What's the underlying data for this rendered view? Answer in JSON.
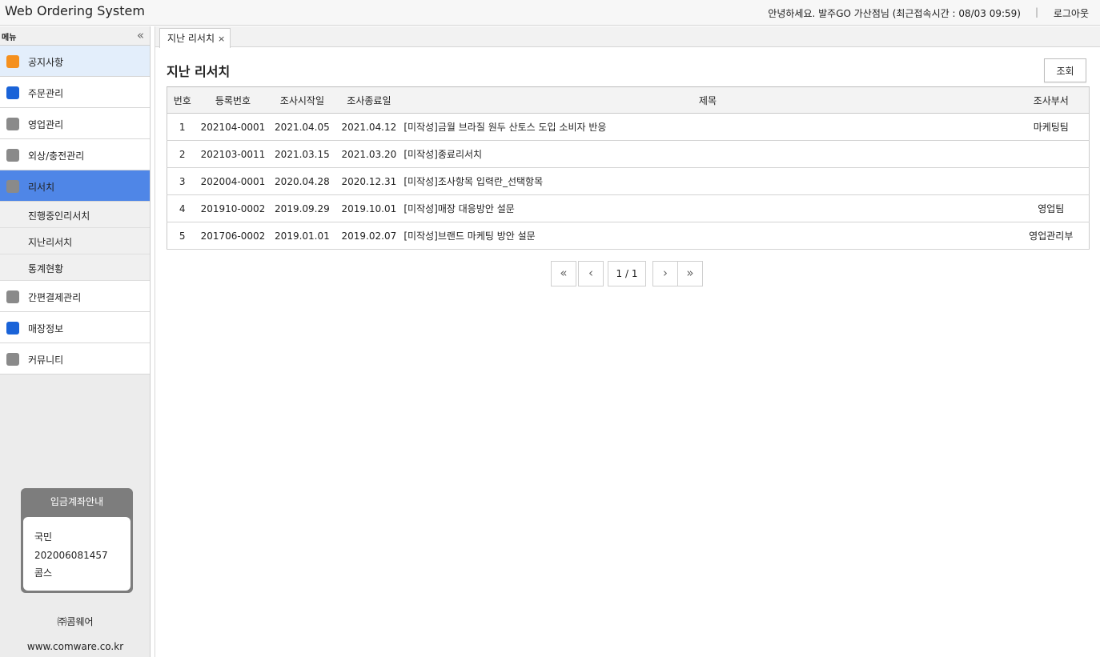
{
  "header": {
    "app_title": "Web Ordering System",
    "user_info": "안녕하세요. 발주GO 가산점님 (최근접속시간 : 08/03 09:59)",
    "separator": "|",
    "logout_label": "로그아웃"
  },
  "sidebar": {
    "menu_label": "메뉴",
    "collapse_icon": "«",
    "items": [
      {
        "label": "공지사항",
        "icon_color": "#f5901e"
      },
      {
        "label": "주문관리",
        "icon_color": "#1a63d8"
      },
      {
        "label": "영업관리",
        "icon_color": "#8a8a8a"
      },
      {
        "label": "외상/충전관리",
        "icon_color": "#8a8a8a"
      },
      {
        "label": "리서치",
        "icon_color": "#8a8a8a",
        "active": true
      },
      {
        "label": "간편결제관리",
        "icon_color": "#8a8a8a"
      },
      {
        "label": "매장정보",
        "icon_color": "#1a63d8"
      },
      {
        "label": "커뮤니티",
        "icon_color": "#8a8a8a"
      }
    ],
    "submenu": [
      "진행중인리서치",
      "지난리서치",
      "통계현황"
    ],
    "account_box": {
      "title": "입금계좌안내",
      "bank": "국민",
      "number": "202006081457",
      "holder": "콤스"
    },
    "company": "㈜콤웨어",
    "website": "www.comware.co.kr"
  },
  "tabs": [
    {
      "label": "지난 리서치",
      "close": "×"
    }
  ],
  "main": {
    "title": "지난 리서치",
    "search_button": "조회",
    "columns": [
      "번호",
      "등록번호",
      "조사시작일",
      "조사종료일",
      "제목",
      "조사부서"
    ],
    "rows": [
      [
        "1",
        "202104-0001",
        "2021.04.05",
        "2021.04.12",
        "[미작성]금월 브라질 원두 산토스 도입 소비자 반응",
        "마케팅팀"
      ],
      [
        "2",
        "202103-0011",
        "2021.03.15",
        "2021.03.20",
        "[미작성]종료리서치",
        ""
      ],
      [
        "3",
        "202004-0001",
        "2020.04.28",
        "2020.12.31",
        "[미작성]조사항목 입력란_선택항목",
        ""
      ],
      [
        "4",
        "201910-0002",
        "2019.09.29",
        "2019.10.01",
        "[미작성]매장 대응방안 설문",
        "영업팀"
      ],
      [
        "5",
        "201706-0002",
        "2019.01.01",
        "2019.02.07",
        "[미작성]브랜드 마케팅 방안 설문",
        "영업관리부"
      ]
    ],
    "pagination": {
      "first": "«",
      "prev": "‹",
      "page_info": "1 / 1",
      "next": "›",
      "last": "»"
    }
  },
  "colors": {
    "active_menu": "#4f86e7",
    "highlight_menu": "#e3eefb"
  }
}
